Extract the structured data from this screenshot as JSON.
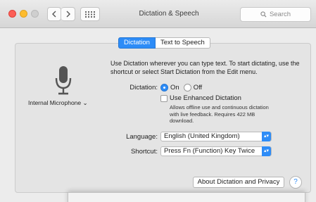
{
  "window": {
    "title": "Dictation & Speech",
    "search_placeholder": "Search"
  },
  "tabs": [
    {
      "label": "Dictation",
      "active": true
    },
    {
      "label": "Text to Speech",
      "active": false
    }
  ],
  "microphone": {
    "label": "Internal Microphone ⌄"
  },
  "dictation": {
    "intro": "Use Dictation wherever you can type text. To start dictating, use the shortcut or select Start Dictation from the Edit menu.",
    "label": "Dictation:",
    "on_label": "On",
    "off_label": "Off",
    "selected": "On"
  },
  "enhanced": {
    "label": "Use Enhanced Dictation",
    "checked": false,
    "description": "Allows offline use and continuous dictation with live feedback. Requires 422 MB download."
  },
  "language": {
    "label": "Language:",
    "value": "English (United Kingdom)"
  },
  "shortcut": {
    "label": "Shortcut:",
    "value": "Press Fn (Function) Key Twice"
  },
  "buttons": {
    "about": "About Dictation and Privacy",
    "help": "?"
  },
  "colors": {
    "accent": "#2d8cf7",
    "close": "#fc5f57",
    "minimize": "#fdbc2e"
  }
}
